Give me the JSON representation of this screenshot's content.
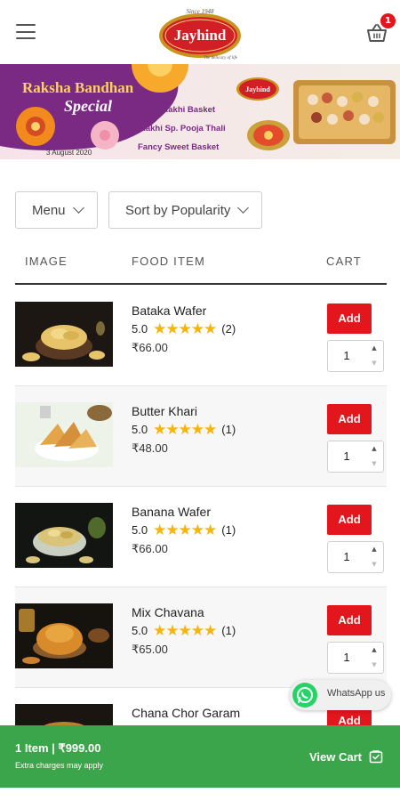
{
  "header": {
    "logo_text": "Jayhind",
    "logo_since": "Since 1948",
    "logo_tagline": "The delicacy of life",
    "cart_count": "1"
  },
  "banner": {
    "title_line1": "Raksha Bandhan",
    "title_line2": "Special",
    "date": "3 August 2020",
    "items": [
      "Sp. Rakhi Basket",
      "Rakhi Sp. Pooja Thali",
      "Fancy Sweet Basket"
    ],
    "logo_text": "Jayhind"
  },
  "filters": {
    "menu_label": "Menu",
    "sort_label": "Sort by Popularity"
  },
  "table": {
    "col_image": "IMAGE",
    "col_food": "FOOD ITEM",
    "col_cart": "CART"
  },
  "products": [
    {
      "name": "Bataka Wafer",
      "rating": "5.0",
      "stars": "★★★★★",
      "reviews": "(2)",
      "price": "₹66.00",
      "add_label": "Add",
      "qty": "1"
    },
    {
      "name": "Butter Khari",
      "rating": "5.0",
      "stars": "★★★★★",
      "reviews": "(1)",
      "price": "₹48.00",
      "add_label": "Add",
      "qty": "1"
    },
    {
      "name": "Banana Wafer",
      "rating": "5.0",
      "stars": "★★★★★",
      "reviews": "(1)",
      "price": "₹66.00",
      "add_label": "Add",
      "qty": "1"
    },
    {
      "name": "Mix Chavana",
      "rating": "5.0",
      "stars": "★★★★★",
      "reviews": "(1)",
      "price": "₹65.00",
      "add_label": "Add",
      "qty": "1"
    },
    {
      "name": "Chana Chor Garam",
      "add_label": "Add"
    }
  ],
  "whatsapp": {
    "label": "WhatsApp us"
  },
  "cart_bar": {
    "summary": "1 Item  |  ₹999.00",
    "note": "Extra charges may apply",
    "view_cart": "View Cart"
  },
  "colors": {
    "accent_red": "#e3161d",
    "cart_bar_green": "#3aa54a",
    "star_yellow": "#f5b50a",
    "whatsapp_green": "#25d366"
  }
}
